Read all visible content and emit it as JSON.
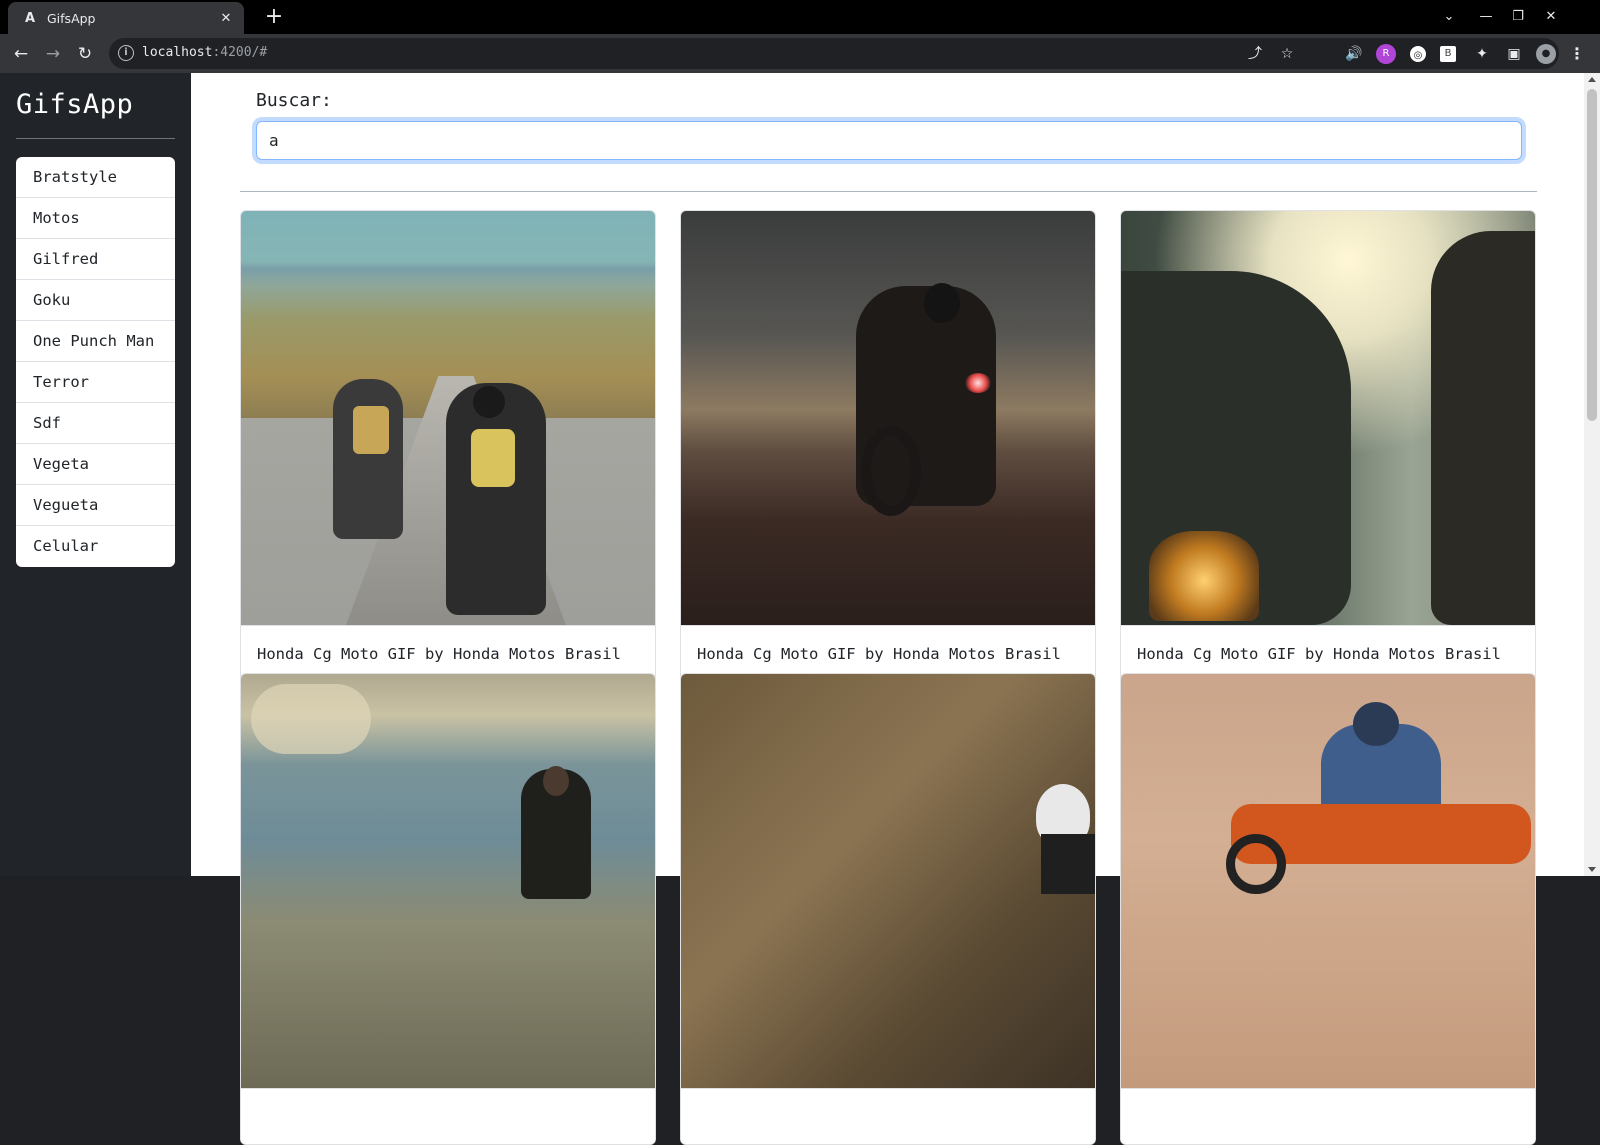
{
  "browser": {
    "tab_title": "GifsApp",
    "url_host": "localhost",
    "url_rest": ":4200/#"
  },
  "sidebar": {
    "brand": "GifsApp",
    "history": [
      "Bratstyle",
      "Motos",
      "Gilfred",
      "Goku",
      "One Punch Man",
      "Terror",
      "Sdf",
      "Vegeta",
      "Vegueta",
      "Celular"
    ]
  },
  "search": {
    "label": "Buscar:",
    "value": "a"
  },
  "gifs": [
    {
      "title": "Honda Cg Moto GIF by Honda Motos Brasil"
    },
    {
      "title": "Honda Cg Moto GIF by Honda Motos Brasil"
    },
    {
      "title": "Honda Cg Moto GIF by Honda Motos Brasil"
    },
    {
      "title": ""
    },
    {
      "title": ""
    },
    {
      "title": ""
    }
  ],
  "colors": {
    "sidebar_bg": "#212529",
    "focus_border": "#86b7fe"
  }
}
